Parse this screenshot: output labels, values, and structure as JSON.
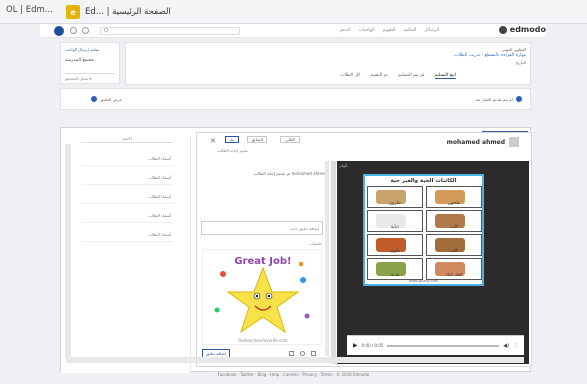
{
  "browser": {
    "tab_a": "OL | Edm...",
    "tab_b_icon": "e",
    "tab_b": "Ed... | الصفحة الرئيسية"
  },
  "navbar": {
    "search_icon": "Q",
    "search_placeholder": "",
    "items": [
      "الدعم",
      "الواجبات",
      "التقويم",
      "المكتبة",
      "الرسائل"
    ],
    "brand": "edmodo"
  },
  "left_panel": {
    "link1": "عملية إرسال الواجب",
    "label": "مجتمع المدرسة",
    "select": "سجل المجتمع",
    "select_sub": "دروس مجتمع"
  },
  "post": {
    "line1": "التطوير المهني",
    "line2": "مهارة القراءة بالمقطع - تدريب الطلاب",
    "line3": "التاريخ"
  },
  "post_tabs": [
    "اتبع التسليم",
    "لم يتم التسليم",
    "تم التقييم",
    "كل الطلاب"
  ],
  "toggle_label": "عرض التعليق",
  "notice": "لم يتم تقديم العمل بعد",
  "viewer": {
    "student_name": "mohamed ahmed",
    "top_right_btn": "تقديم إجابة الطالب",
    "close": "✕",
    "btn_next": "التالي",
    "btn_prev": "السابق",
    "btn_done": "تم",
    "btn_x": "إلغاء",
    "status_line": "تقييم إجابة الطالب",
    "comment_text": "تم تقديم إجابة الطالب mohamed ahmed",
    "comment_input": "إضافة تعليق جديد",
    "comment_label": "تعليقات",
    "submit": "إضافة تعليق",
    "list_header": "الاسم",
    "list_items": [
      "أسماء الطلاب",
      "أسماء الطلاب",
      "أسماء الطلاب",
      "أسماء الطلاب",
      "أسماء الطلاب"
    ]
  },
  "worksheet": {
    "corner_text": "ألوان",
    "title": "الكائنات الحية والغير حية",
    "cells": [
      {
        "label": "حلزون",
        "color": "#c9a36b"
      },
      {
        "label": "ملحون",
        "color": "#d39a5a"
      },
      {
        "label": "ذبابة",
        "color": "#e8e8e8"
      },
      {
        "label": "كلب",
        "color": "#b07a4a"
      },
      {
        "label": "حلوى",
        "color": "#c15c2a"
      },
      {
        "label": "هدية",
        "color": "#88a34a"
      },
      {
        "label": "كعك كيك",
        "color": "#d18a5f"
      },
      {
        "label": "كلب",
        "color": "#a06d3a"
      }
    ],
    "footer": "www.galaxy.com"
  },
  "great_job": {
    "text": "Great Job!",
    "caption": "theteachersfavorite.com"
  },
  "player": {
    "time": "0:00 / 0:05"
  },
  "footer": "Facebook · Twitter · Blog · Help · Careers · Privacy · Terms · © 2018 Edmodo"
}
